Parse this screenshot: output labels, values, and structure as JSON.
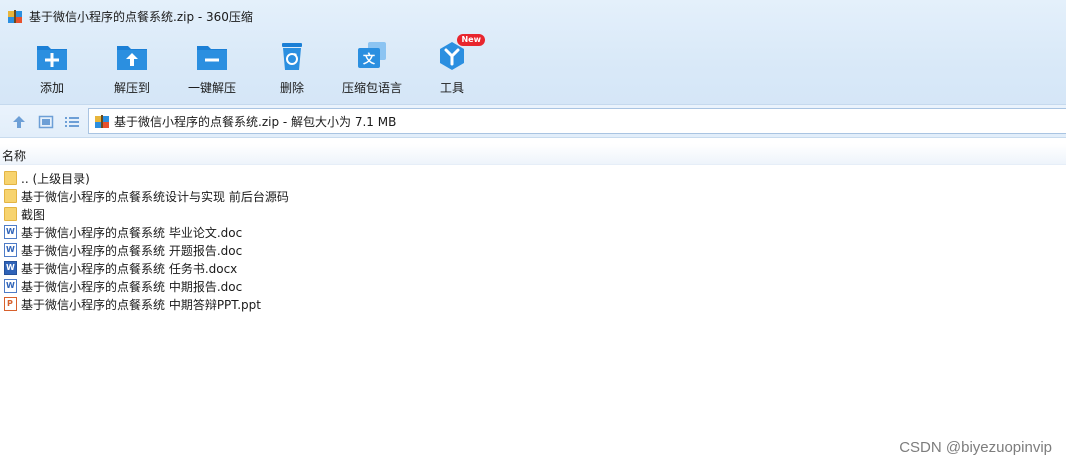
{
  "window": {
    "title": "基于微信小程序的点餐系统.zip - 360压缩"
  },
  "toolbar": {
    "items": [
      {
        "label": "添加",
        "icon": "add-icon"
      },
      {
        "label": "解压到",
        "icon": "extract-to-icon"
      },
      {
        "label": "一键解压",
        "icon": "one-click-extract-icon"
      },
      {
        "label": "删除",
        "icon": "delete-icon"
      },
      {
        "label": "压缩包语言",
        "icon": "archive-language-icon"
      },
      {
        "label": "工具",
        "icon": "tools-icon",
        "badge": "New"
      }
    ]
  },
  "nav": {
    "path": "基于微信小程序的点餐系统.zip - 解包大小为 7.1 MB"
  },
  "columns": {
    "name": "名称"
  },
  "files": [
    {
      "name": ".. (上级目录)",
      "type": "folder"
    },
    {
      "name": "基于微信小程序的点餐系统设计与实现 前后台源码",
      "type": "folder"
    },
    {
      "name": "截图",
      "type": "folder"
    },
    {
      "name": "基于微信小程序的点餐系统 毕业论文.doc",
      "type": "doc"
    },
    {
      "name": "基于微信小程序的点餐系统 开题报告.doc",
      "type": "doc"
    },
    {
      "name": "基于微信小程序的点餐系统 任务书.docx",
      "type": "docx"
    },
    {
      "name": "基于微信小程序的点餐系统 中期报告.doc",
      "type": "doc"
    },
    {
      "name": "基于微信小程序的点餐系统 中期答辩PPT.ppt",
      "type": "ppt"
    }
  ],
  "watermark": "CSDN @biyezuopinvip",
  "colors": {
    "accent": "#2b8fe0",
    "accent_dark": "#1b6fc0",
    "folder": "#f7d36e",
    "badge": "#e8262e"
  }
}
